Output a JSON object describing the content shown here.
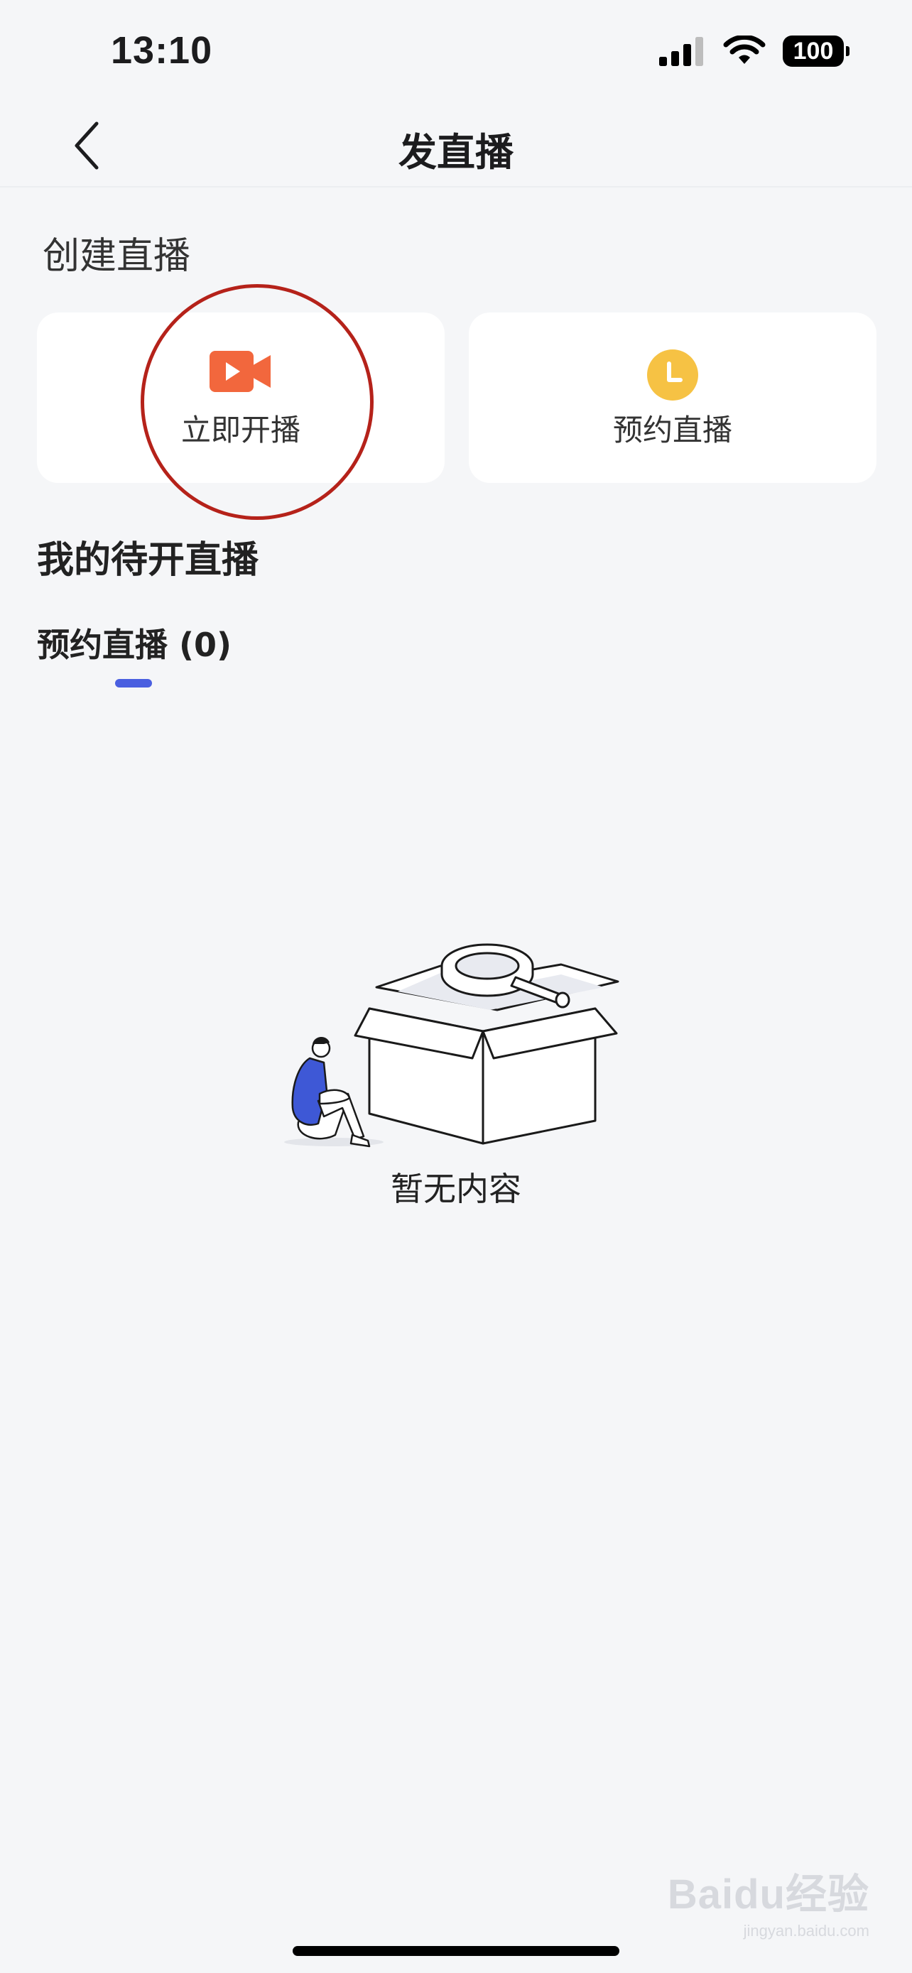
{
  "status_bar": {
    "time": "13:10",
    "battery": "100"
  },
  "nav": {
    "title": "发直播",
    "back_icon": "chevron-left-icon"
  },
  "create_section": {
    "title": "创建直播",
    "cards": [
      {
        "label": "立即开播",
        "icon": "video-camera-icon",
        "icon_color": "#f2673d"
      },
      {
        "label": "预约直播",
        "icon": "clock-icon",
        "icon_color": "#f6c244"
      }
    ]
  },
  "pending_section": {
    "title": "我的待开直播",
    "tab_label": "预约直播 (0)",
    "tab_indicator_color": "#4a5fe0"
  },
  "empty_state": {
    "text": "暂无内容",
    "icon": "empty-box-illustration"
  },
  "watermark": {
    "main": "Baidu经验",
    "sub": "jingyan.baidu.com"
  },
  "highlight": {
    "color": "#b5221a"
  }
}
